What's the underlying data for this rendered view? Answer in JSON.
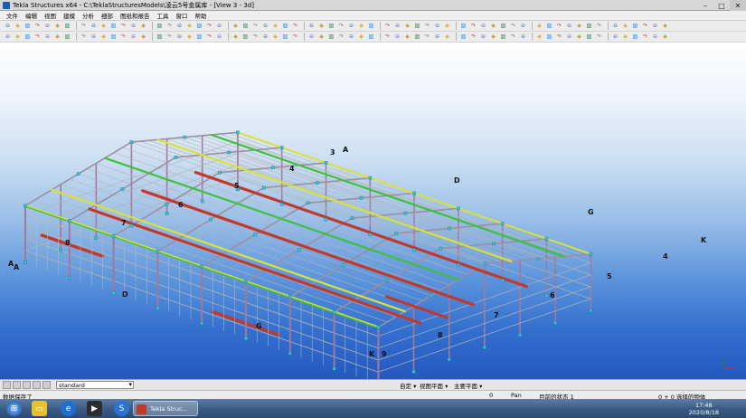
{
  "window": {
    "title": "Tekla Structures x64 - C:\\TeklaStructuresModels\\凌云5号金属库 - [View 3 - 3d]"
  },
  "menu": {
    "items": [
      "文件",
      "编辑",
      "视图",
      "建模",
      "分析",
      "细部",
      "图纸和报告",
      "工具",
      "窗口",
      "帮助"
    ]
  },
  "viewport": {
    "grid_labels": [
      "A",
      "A",
      "8",
      "7",
      "6",
      "5",
      "4",
      "3",
      "A",
      "D",
      "D",
      "G",
      "G",
      "K",
      "K",
      "9",
      "8",
      "7",
      "6",
      "5",
      "4"
    ]
  },
  "cmdbar": {
    "combo_value": "standard",
    "filters": [
      "自定 ▾",
      "视图平面 ▾",
      "主要平面 ▾"
    ]
  },
  "statusbar": {
    "message": "数据保存了",
    "value_0": "0",
    "mode": "Pan",
    "state": "目前的状态 1",
    "selection": "0 + 0 选择的物体"
  },
  "taskbar": {
    "active_item": "Tekla Struc...",
    "time": "17:48",
    "date": "2020/8/18"
  },
  "colors": {
    "column": "#a17a9a",
    "rafter": "#9b8fa3",
    "purlin": "#b5b5b5",
    "eave": "#d8e23a",
    "tie_beam": "#c03a2b",
    "connection": "#35c6d8",
    "green_strip": "#3fbf3a"
  }
}
